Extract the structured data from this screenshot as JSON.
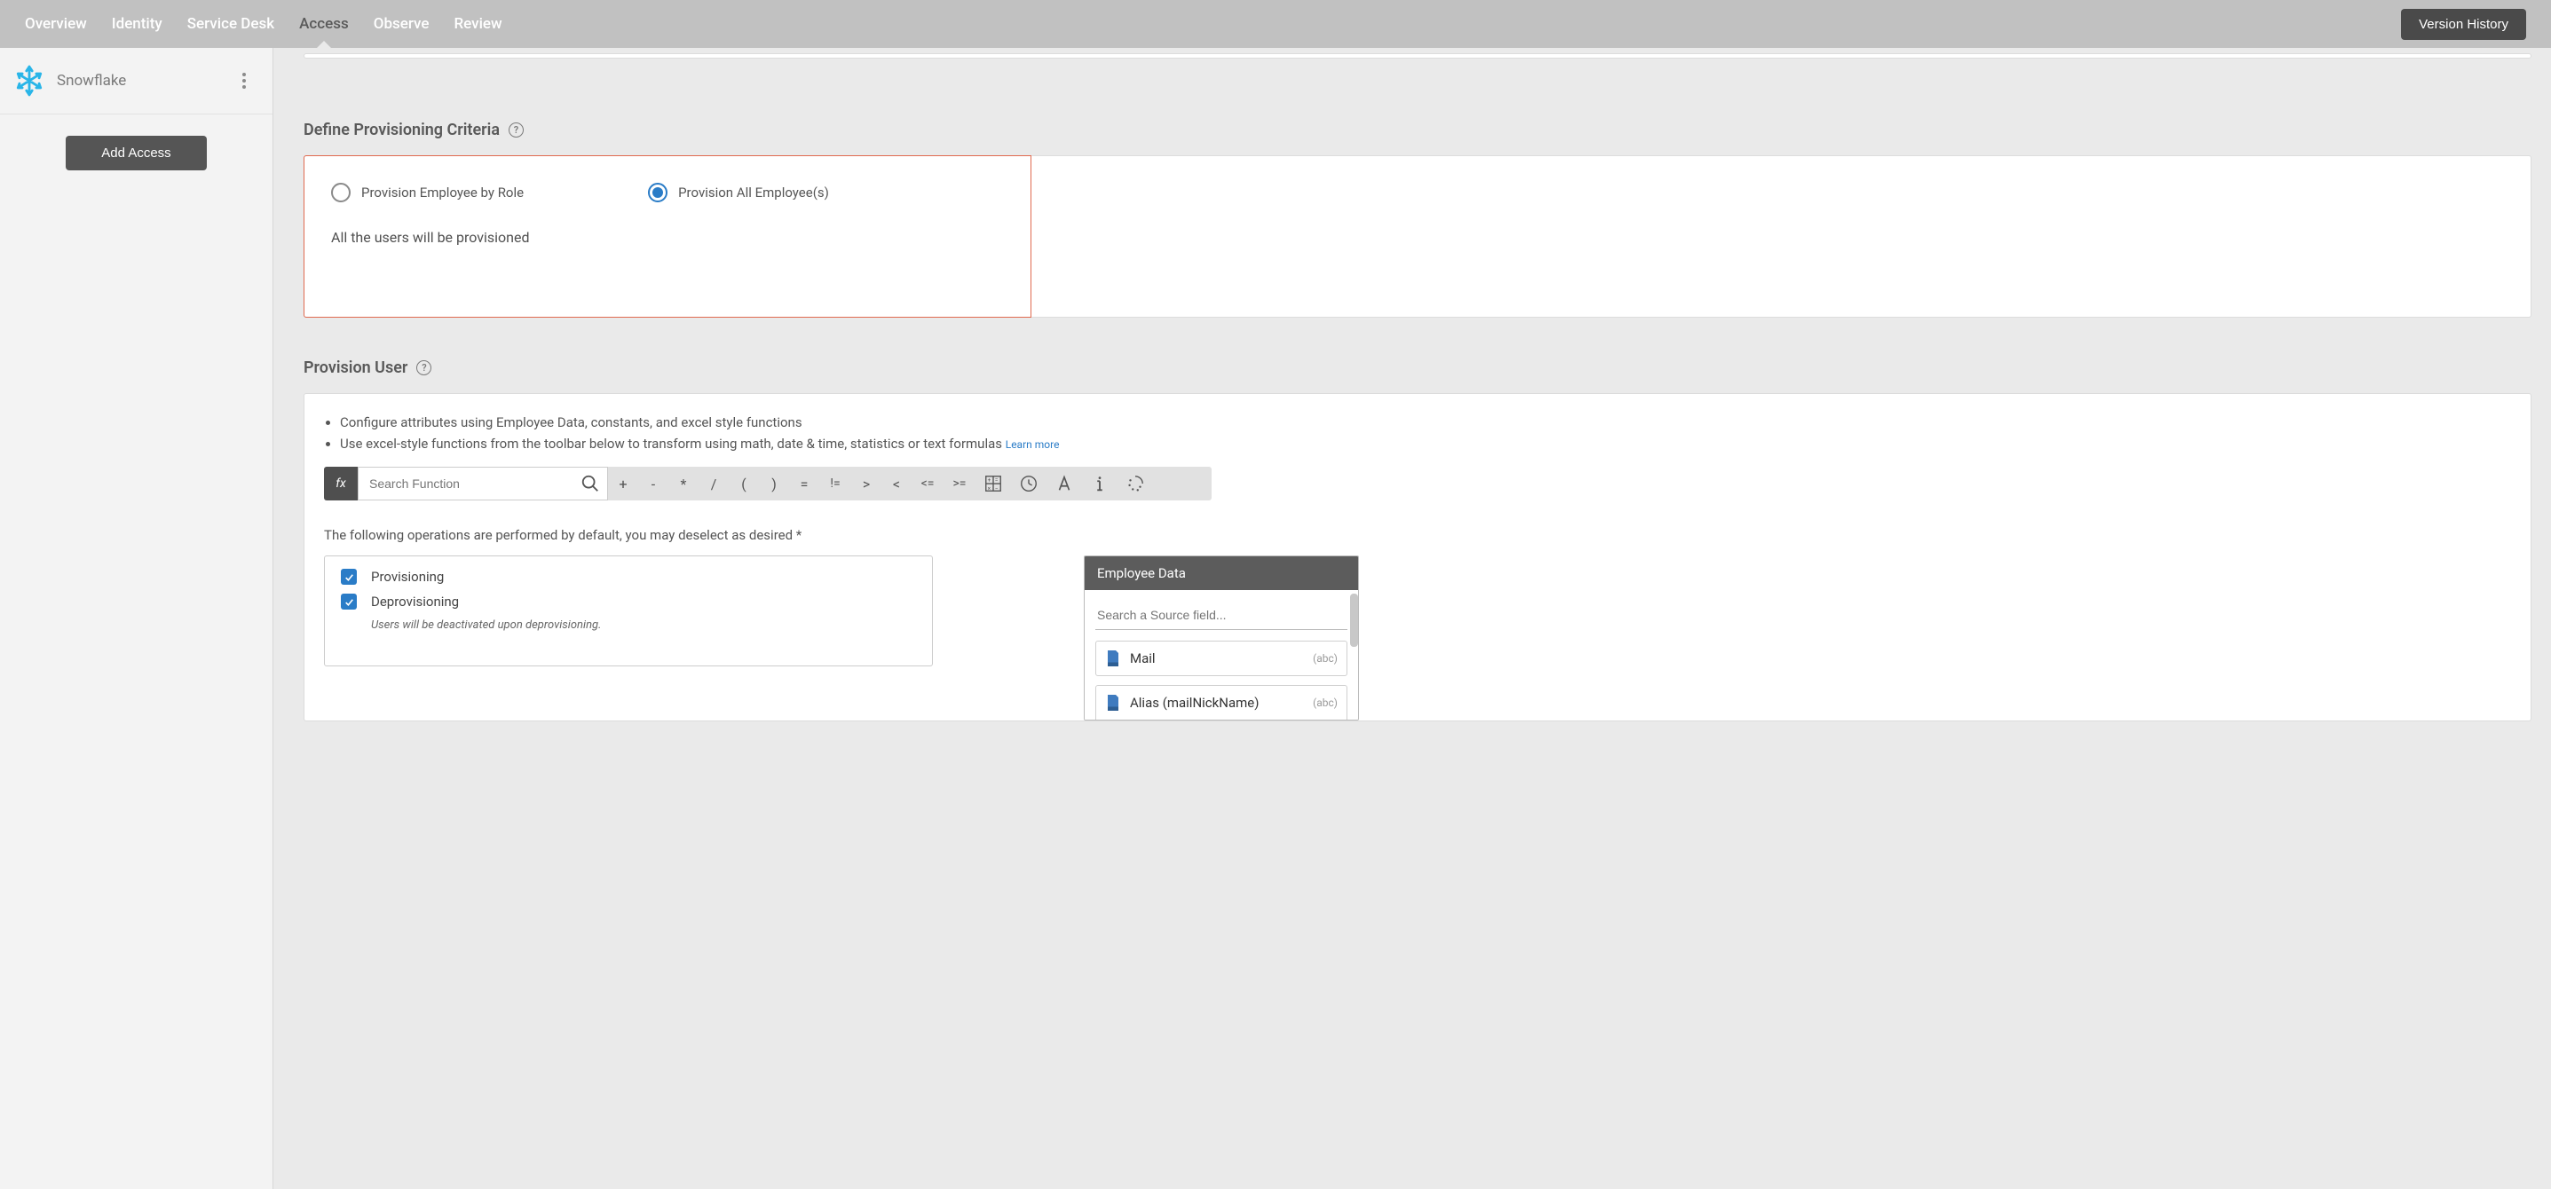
{
  "tabs": [
    "Overview",
    "Identity",
    "Service Desk",
    "Access",
    "Observe",
    "Review"
  ],
  "active_tab_index": 3,
  "version_history_label": "Version History",
  "sidebar": {
    "app_name": "Snowflake",
    "add_access_label": "Add Access"
  },
  "criteria": {
    "title": "Define Provisioning Criteria",
    "options": [
      {
        "label": "Provision Employee by Role",
        "selected": false
      },
      {
        "label": "Provision All Employee(s)",
        "selected": true
      }
    ],
    "description": "All the users will be provisioned"
  },
  "provision_user": {
    "title": "Provision User",
    "bullets": [
      "Configure attributes using Employee Data, constants, and excel style functions",
      "Use excel-style functions from the toolbar below to transform using math, date & time, statistics or text formulas"
    ],
    "learn_more": "Learn more",
    "fx_label": "fx",
    "search_placeholder": "Search Function",
    "operators": [
      "+",
      "-",
      "*",
      "/",
      "(",
      ")",
      "=",
      "!=",
      ">",
      "<",
      "<=",
      ">="
    ],
    "ops_note": "The following operations are performed by default, you may deselect as desired *",
    "checkboxes": [
      {
        "label": "Provisioning",
        "checked": true,
        "note": ""
      },
      {
        "label": "Deprovisioning",
        "checked": true,
        "note": "Users will be deactivated upon deprovisioning."
      }
    ]
  },
  "employee_data": {
    "title": "Employee Data",
    "search_placeholder": "Search a Source field...",
    "fields": [
      {
        "name": "Mail",
        "type": "(abc)"
      },
      {
        "name": "Alias (mailNickName)",
        "type": "(abc)"
      }
    ]
  }
}
